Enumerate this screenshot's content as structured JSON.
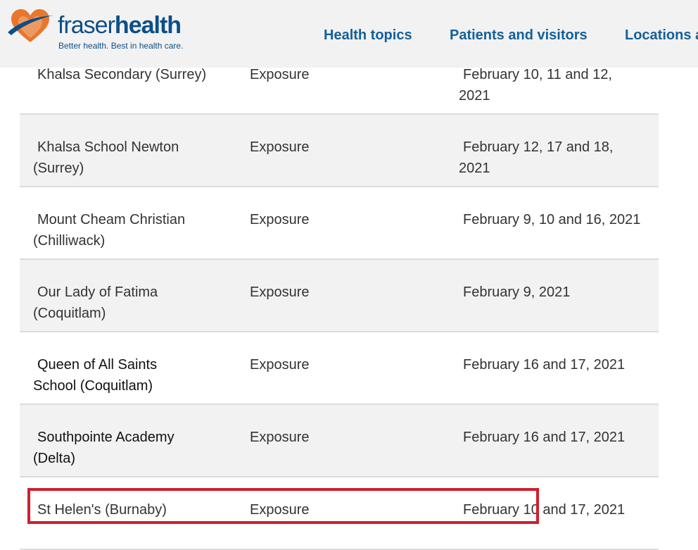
{
  "header": {
    "logo": {
      "name_light": "fraser",
      "name_bold": "health",
      "tagline": "Better health. Best in health care."
    },
    "nav": [
      {
        "label": "Health topics"
      },
      {
        "label": "Patients and visitors"
      },
      {
        "label": "Locations a"
      }
    ]
  },
  "rows": [
    {
      "school_line1": "Khalsa Secondary (Surrey)",
      "school_line2": "",
      "type": "Exposure",
      "dates_line1": "February 10, 11 and 12,",
      "dates_line2": "2021"
    },
    {
      "school_line1": "Khalsa School Newton",
      "school_line2": "(Surrey)",
      "type": "Exposure",
      "dates_line1": "February 12, 17 and 18,",
      "dates_line2": "2021"
    },
    {
      "school_line1": "Mount Cheam Christian",
      "school_line2": "(Chilliwack)",
      "type": "Exposure",
      "dates_line1": "February 9, 10 and 16, 2021",
      "dates_line2": ""
    },
    {
      "school_line1": "Our Lady of Fatima",
      "school_line2": "(Coquitlam)",
      "type": "Exposure",
      "dates_line1": "February 9, 2021",
      "dates_line2": ""
    },
    {
      "school_line1": "Queen of All Saints",
      "school_line2": "School (Coquitlam)",
      "type": "Exposure",
      "dates_line1": "February 16 and 17, 2021",
      "dates_line2": ""
    },
    {
      "school_line1": "Southpointe Academy",
      "school_line2": "(Delta)",
      "type": "Exposure",
      "dates_line1": "February 16 and 17, 2021",
      "dates_line2": ""
    },
    {
      "school_line1": "St Helen's (Burnaby)",
      "school_line2": "",
      "type": "Exposure",
      "dates_line1": "February 10 and 17, 2021",
      "dates_line2": ""
    }
  ],
  "colors": {
    "brand_blue": "#0b4f88",
    "nav_blue": "#13609b",
    "logo_orange": "#e8772e",
    "highlight_red": "#d01f2e",
    "row_shade": "#f2f2f2"
  }
}
